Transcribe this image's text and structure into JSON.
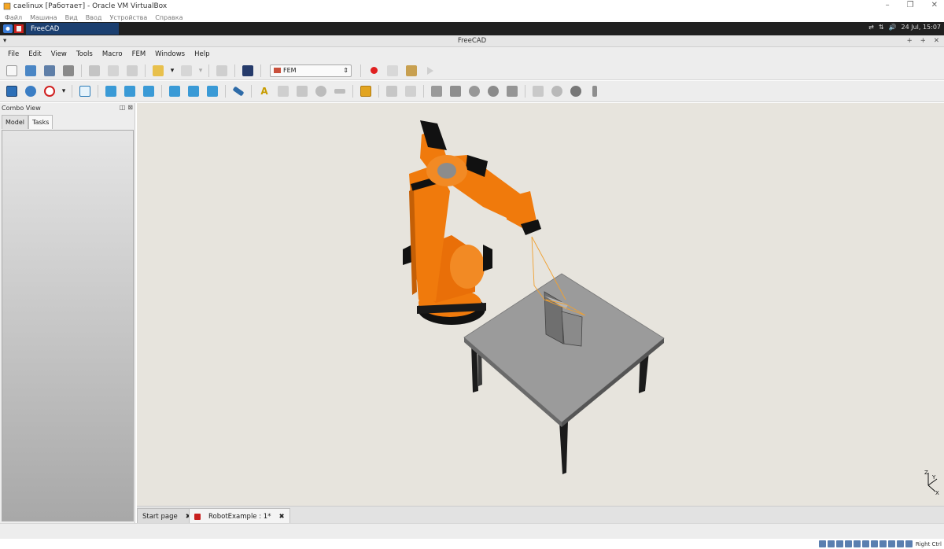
{
  "virtualbox": {
    "title": "caelinux [Работает] - Oracle VM VirtualBox",
    "menu": [
      "Файл",
      "Машина",
      "Вид",
      "Ввод",
      "Устройства",
      "Справка"
    ],
    "host_key": "Right Ctrl"
  },
  "taskbar": {
    "app_label": "FreeCAD",
    "datetime": "24 Jul, 15:07"
  },
  "window": {
    "title": "FreeCAD"
  },
  "menubar": [
    "File",
    "Edit",
    "View",
    "Tools",
    "Macro",
    "FEM",
    "Windows",
    "Help"
  ],
  "workbench": {
    "selected": "FEM"
  },
  "combo": {
    "title": "Combo View",
    "tabs": [
      "Model",
      "Tasks"
    ],
    "active_tab": "Tasks"
  },
  "doc_tabs": [
    "Start page",
    "RobotExample : 1*"
  ],
  "axis_labels": {
    "x": "X",
    "y": "Y",
    "z": "Z"
  },
  "colors": {
    "robot": "#f07a0c",
    "table_top": "#9b9b9b",
    "background": "#e7e4dd",
    "taskbar_active": "#1b3f70"
  }
}
